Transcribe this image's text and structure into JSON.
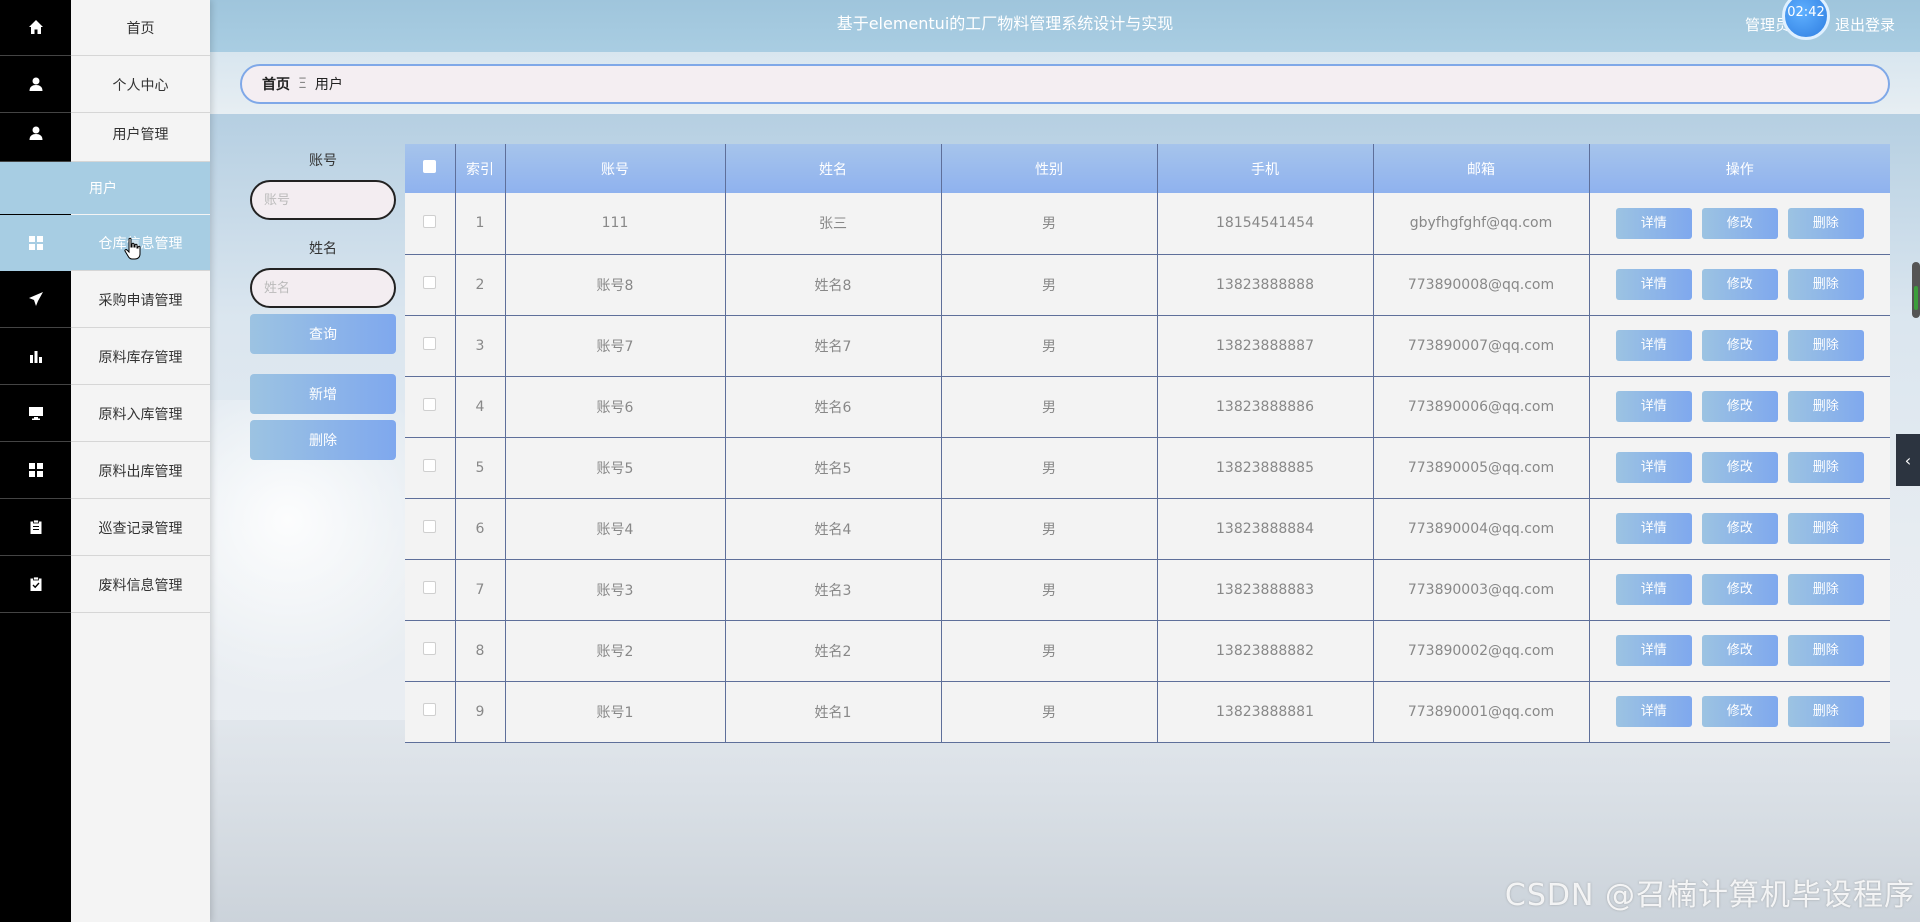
{
  "header": {
    "title": "基于elementui的工厂物料管理系统设计与实现",
    "user_label": "管理员",
    "clock": "02:42",
    "logout": "退出登录"
  },
  "sidebar": {
    "items": [
      {
        "label": "首页",
        "icon": "home-icon"
      },
      {
        "label": "个人中心",
        "icon": "user-icon"
      },
      {
        "label": "用户管理",
        "icon": "user-icon"
      },
      {
        "label": "仓库信息管理",
        "icon": "grid-icon"
      },
      {
        "label": "采购申请管理",
        "icon": "paper-plane-icon"
      },
      {
        "label": "原料库存管理",
        "icon": "bar-chart-icon"
      },
      {
        "label": "原料入库管理",
        "icon": "monitor-icon"
      },
      {
        "label": "原料出库管理",
        "icon": "grid-icon"
      },
      {
        "label": "巡查记录管理",
        "icon": "clipboard-icon"
      },
      {
        "label": "废料信息管理",
        "icon": "clipboard-check-icon"
      }
    ],
    "submenu_label": "用户"
  },
  "breadcrumb": {
    "home": "首页",
    "separator": "Ξ",
    "current": "用户"
  },
  "search": {
    "account_label": "账号",
    "account_placeholder": "账号",
    "name_label": "姓名",
    "name_placeholder": "姓名",
    "query_button": "查询",
    "add_button": "新增",
    "delete_button": "删除"
  },
  "table": {
    "columns": [
      "索引",
      "账号",
      "姓名",
      "性别",
      "手机",
      "邮箱",
      "操作"
    ],
    "action_labels": {
      "detail": "详情",
      "edit": "修改",
      "delete": "删除"
    },
    "rows": [
      {
        "index": "1",
        "account": "111",
        "name": "张三",
        "gender": "男",
        "phone": "18154541454",
        "email": "gbyfhgfghf@qq.com"
      },
      {
        "index": "2",
        "account": "账号8",
        "name": "姓名8",
        "gender": "男",
        "phone": "13823888888",
        "email": "773890008@qq.com"
      },
      {
        "index": "3",
        "account": "账号7",
        "name": "姓名7",
        "gender": "男",
        "phone": "13823888887",
        "email": "773890007@qq.com"
      },
      {
        "index": "4",
        "account": "账号6",
        "name": "姓名6",
        "gender": "男",
        "phone": "13823888886",
        "email": "773890006@qq.com"
      },
      {
        "index": "5",
        "account": "账号5",
        "name": "姓名5",
        "gender": "男",
        "phone": "13823888885",
        "email": "773890005@qq.com"
      },
      {
        "index": "6",
        "account": "账号4",
        "name": "姓名4",
        "gender": "男",
        "phone": "13823888884",
        "email": "773890004@qq.com"
      },
      {
        "index": "7",
        "account": "账号3",
        "name": "姓名3",
        "gender": "男",
        "phone": "13823888883",
        "email": "773890003@qq.com"
      },
      {
        "index": "8",
        "account": "账号2",
        "name": "姓名2",
        "gender": "男",
        "phone": "13823888882",
        "email": "773890002@qq.com"
      },
      {
        "index": "9",
        "account": "账号1",
        "name": "姓名1",
        "gender": "男",
        "phone": "13823888881",
        "email": "773890001@qq.com"
      }
    ]
  },
  "watermark": "CSDN @召楠计算机毕设程序",
  "colors": {
    "header_bg": "#a9cde2",
    "sidebar_active": "#a7cde3",
    "button_start": "#9cc3e2",
    "button_end": "#7fa8ee",
    "table_header": "#8fb2ee"
  }
}
